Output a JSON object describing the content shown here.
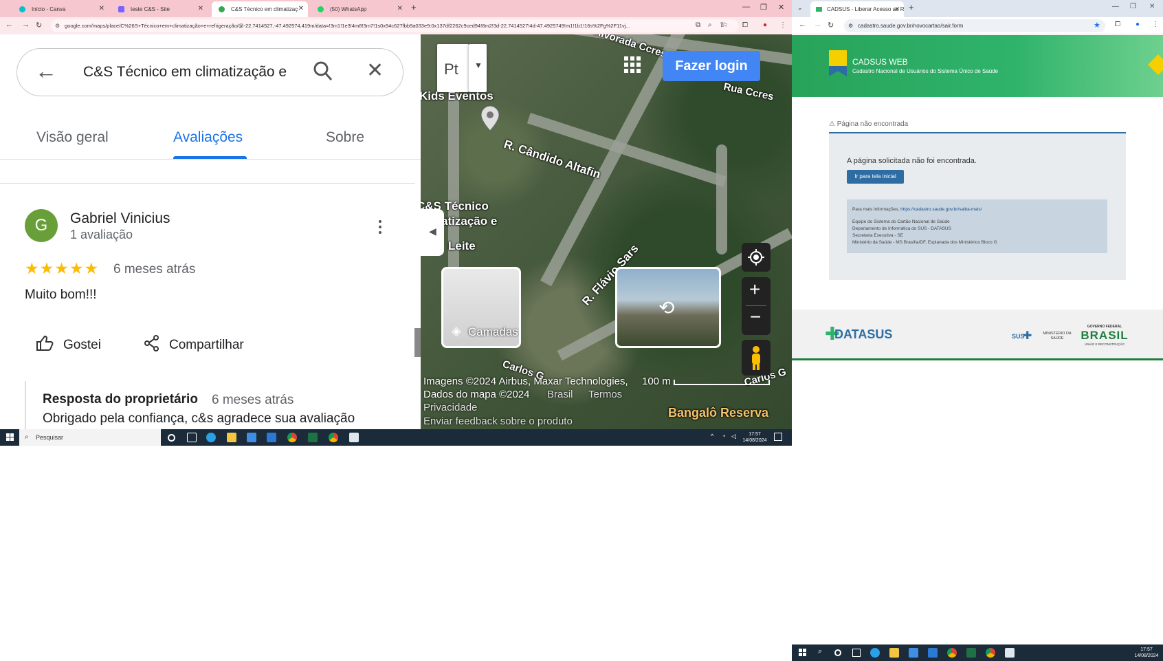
{
  "left_browser": {
    "tabs": [
      {
        "label": "Início - Canva",
        "color": "#00c4cc"
      },
      {
        "label": "teste C&S - Site",
        "color": "#7b61ff"
      },
      {
        "label": "C&S Técnico em climatização e",
        "color": "#34a853"
      },
      {
        "label": "(50) WhatsApp",
        "color": "#25d366"
      }
    ],
    "url": "google.com/maps/place/C%26S+Técnico+em+climatização+e+refrigeração/@-22.7414527,-47.492574,419m/data=!3m1!1e3!4m8!3m7!1s0x94c627fbb9a033e9:0x137df2262c9ced94!8m2!3d-22.7414527!4d-47.4925749!m1!1b1!16s%2Fg%2F11vj...",
    "search_query": "C&S Técnico em climatização e",
    "panel_tabs": [
      "Visão geral",
      "Avaliações",
      "Sobre"
    ],
    "review": {
      "avatar_letter": "G",
      "author": "Gabriel Vinicius",
      "author_count": "1 avaliação",
      "stars": "★★★★★",
      "rating": 5,
      "when": "6 meses atrás",
      "text": "Muito bom!!!",
      "like_label": "Gostei",
      "share_label": "Compartilhar",
      "owner_title": "Resposta do proprietário",
      "owner_when": "6 meses atrás",
      "owner_text": "Obrigado pela confiança, c&s agradece sua avaliação"
    },
    "map": {
      "login_label": "Fazer login",
      "layers_label": "Camadas",
      "labels": [
        "Kids Eventos",
        "R. Cândido Altafin",
        "C&S Técnico",
        "climatização e",
        "Leite",
        "R. Flávio Sars",
        "Carlos G",
        "Bangalô Reserva",
        "Alvorada Ccres",
        "Rua Ccres",
        "Carlos G"
      ],
      "attribution_1": "Imagens ©2024 Airbus, Maxar Technologies,",
      "attribution_2": "Dados do mapa ©2024",
      "country": "Brasil",
      "terms": "Termos",
      "privacy": "Privacidade",
      "feedback": "Enviar feedback sobre o produto",
      "scale": "100 m"
    },
    "taskbar": {
      "search_placeholder": "Pesquisar",
      "time": "17:57",
      "date": "14/08/2024"
    }
  },
  "right_browser": {
    "tab_label": "CADSUS - Liberar Acesso ao Re",
    "url": "cadastro.saude.gov.br/novocartao/sair.form",
    "header_title": "CADSUS WEB",
    "header_sub": "Cadastro Nacional de Usuários do Sistema Único de Saúde",
    "notfound_heading": "Página não encontrada",
    "message": "A página solicitada não foi encontrada.",
    "button_label": "Ir para tela inicial",
    "info_prefix": "Para mais informações, ",
    "info_link": "https://cadastro.saude.gov.br/saiba-mais/",
    "info_lines": [
      "Equipe do Sistema do Cartão Nacional de Saúde",
      "Departamento de Informática do SUS - DATASUS",
      "Secretaria Executiva - SE",
      "Ministério da Saúde - MS Brasília/DF, Esplanada dos Ministérios Bloco G"
    ],
    "footer_logo": "DATASUS",
    "footer_sus": "SUS",
    "footer_ministerio": "MINISTÉRIO DA SAÚDE",
    "footer_gov": "GOVERNO FEDERAL",
    "footer_brasil": "BRASIL",
    "footer_slogan": "UNIÃO E RECONSTRUÇÃO",
    "taskbar": {
      "time": "17:57",
      "date": "14/08/2024"
    }
  }
}
